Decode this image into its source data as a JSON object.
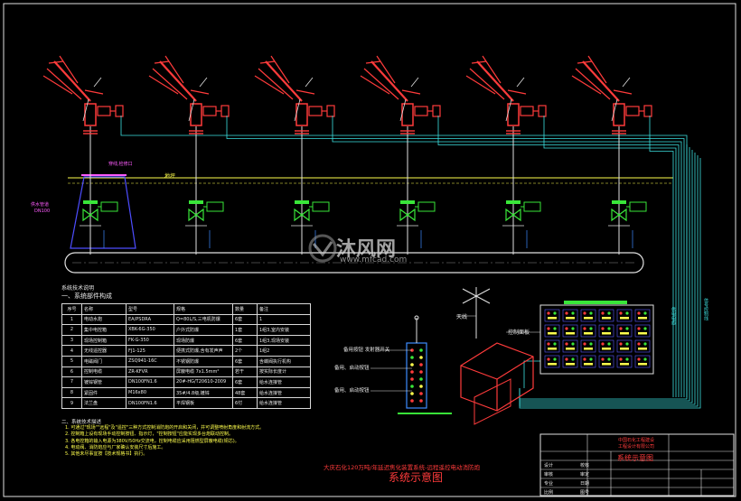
{
  "drawing": {
    "nozzle_count": 6,
    "label_ground": "地坪",
    "label_pit_top": "穿线,检修口",
    "label_pit_left_1": "供水管道",
    "label_pit_left_2": "DN100",
    "label_pipe_vertical": "供水管",
    "label_antenna": "天线",
    "label_control_cabinet": "控制面板",
    "label_right_vertical_1": "供电电缆",
    "label_right_vertical_2": "信号控制线",
    "remote_labels": [
      "备用按钮 发射器开关",
      "备用、启动按钮",
      "备用、启动按钮"
    ],
    "watermark_main": "沐风网",
    "watermark_sub": "www.mfcad.com"
  },
  "spec": {
    "heading_1": "系统技术说明",
    "heading_2": "一、系统部件构成",
    "headers": [
      "序号",
      "名称",
      "型号",
      "规格",
      "数量",
      "备注"
    ],
    "rows": [
      [
        "1",
        "电动水炮",
        "EA/PSDRA",
        "Q=80L/S,三电机防爆",
        "6套",
        "1"
      ],
      [
        "2",
        "集中电控箱",
        "XBK-6G-350",
        "户外式防爆",
        "1套",
        "1组3,室内安装"
      ],
      [
        "3",
        "现场控制箱",
        "FK-G-350",
        "现场防爆",
        "6套",
        "1组3,现场安装"
      ],
      [
        "4",
        "无线遥控器",
        "FJ1-125",
        "便携式防爆,含有发声声",
        "2个",
        "1组2"
      ],
      [
        "5",
        "电磁阀门",
        "ZSQ941-16C",
        "不锈钢防爆",
        "6套",
        "含蝶阀执行机构"
      ],
      [
        "6",
        "控制电缆",
        "ZR-KFVR",
        "屏蔽电缆 7x1.5mm²",
        "若干",
        "按实际长度计"
      ],
      [
        "7",
        "镀锌钢管",
        "DN100FN1.6",
        "20#-HG/T20610-2009",
        "6套",
        "给水连接管"
      ],
      [
        "8",
        "紧固件",
        "M16x80",
        "35#/4.8级,镀锌",
        "48套",
        "给水连接管"
      ],
      [
        "9",
        "法兰盘",
        "DN100FN1.6",
        "平焊钢板",
        "6付",
        "给水连接管"
      ]
    ],
    "notes_heading": "二、系统技术描述",
    "notes": [
      "1. 可通过\"现场\"\"远程\"及\"遥控\"三种方式控制消防炮的开启和关闭，并可调整喷射角度和射流方式。",
      "2. 控制箱上设有现场手动控制按钮、指示灯，\"控制按钮\"应能实现多台炮联动控制。",
      "3. 各电控箱的输入电源为380V/50Hz交流电，控制电缆应采用阻燃型屏蔽电缆(铜芯)。",
      "4. 电动阀、消防炮应与厂家确认安装尺寸后施工。",
      "5. 其他未尽事宜按【技术规格书】执行。"
    ]
  },
  "title_block": {
    "caption_line": "大庆石化120万吨/年延迟焦化装置系统-远程遥控电动消防炮",
    "caption_title": "系统示意图",
    "header_1": "中国石化工程建设",
    "header_2": "工程设计有限公司",
    "drawing_name": "系统示意图",
    "cells": [
      "设计",
      "校核",
      "审核",
      "审定",
      "专业",
      "日期",
      "比例",
      "图号"
    ]
  },
  "colors": {
    "pipe": "#e0e0e0",
    "nozzle": "#ff3b3b",
    "cable": "#3de0e0",
    "valve": "#39e639",
    "ground": "#ffff4d",
    "pit": "#4d4dff",
    "accent": "#ff5cff"
  }
}
